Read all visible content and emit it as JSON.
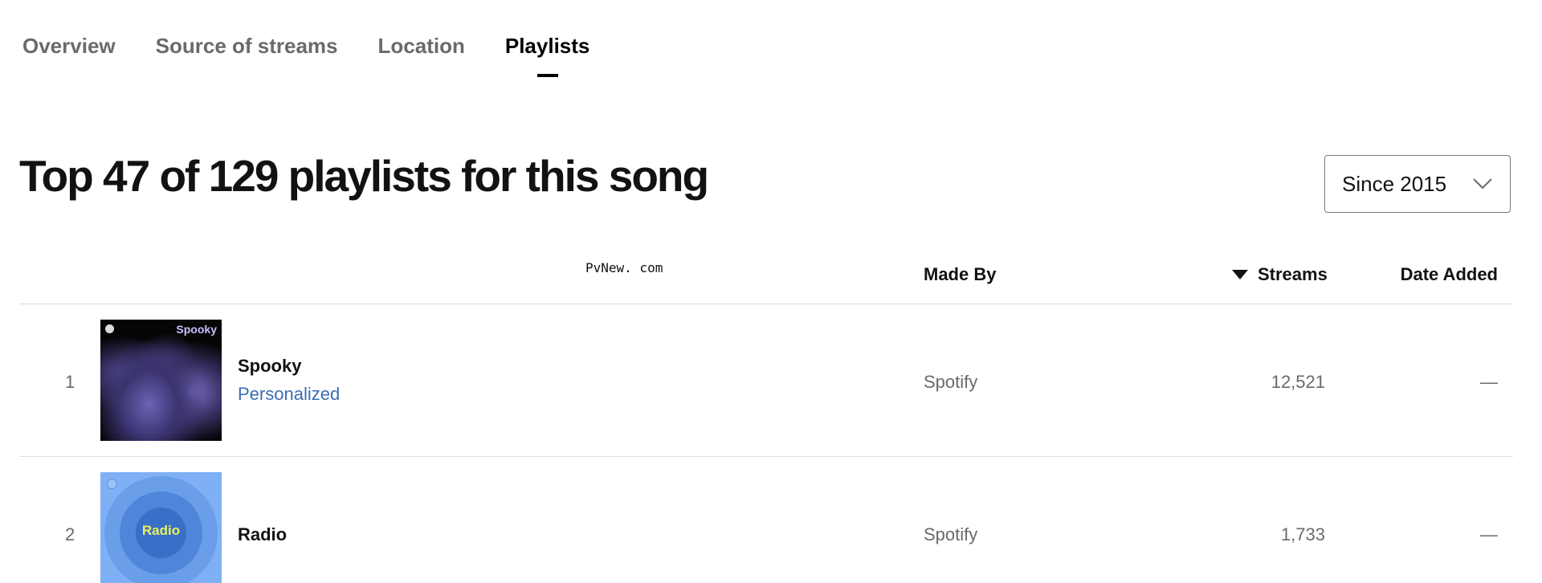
{
  "tabs": [
    {
      "label": "Overview",
      "active": false
    },
    {
      "label": "Source of streams",
      "active": false
    },
    {
      "label": "Location",
      "active": false
    },
    {
      "label": "Playlists",
      "active": true
    }
  ],
  "heading": "Top 47 of 129 playlists for this song",
  "range_select": {
    "value": "Since 2015",
    "icon": "chevron-down-icon"
  },
  "watermark": "PvNew. com",
  "table": {
    "columns": {
      "made_by": "Made By",
      "streams": "Streams",
      "date_added": "Date Added"
    },
    "sort": {
      "column": "Streams",
      "direction": "descending",
      "icon": "sort-desc-icon"
    },
    "rows": [
      {
        "rank": "1",
        "cover_label": "Spooky",
        "name": "Spooky",
        "subtitle": "Personalized",
        "made_by": "Spotify",
        "streams": "12,521",
        "date_added": "—"
      },
      {
        "rank": "2",
        "cover_label": "Radio",
        "name": "Radio",
        "subtitle": "",
        "made_by": "Spotify",
        "streams": "1,733",
        "date_added": "—"
      }
    ]
  },
  "colors": {
    "text_primary": "#121212",
    "text_secondary": "#6a6a6a",
    "link_blue": "#3b6db5",
    "divider": "#dcdcdc"
  }
}
